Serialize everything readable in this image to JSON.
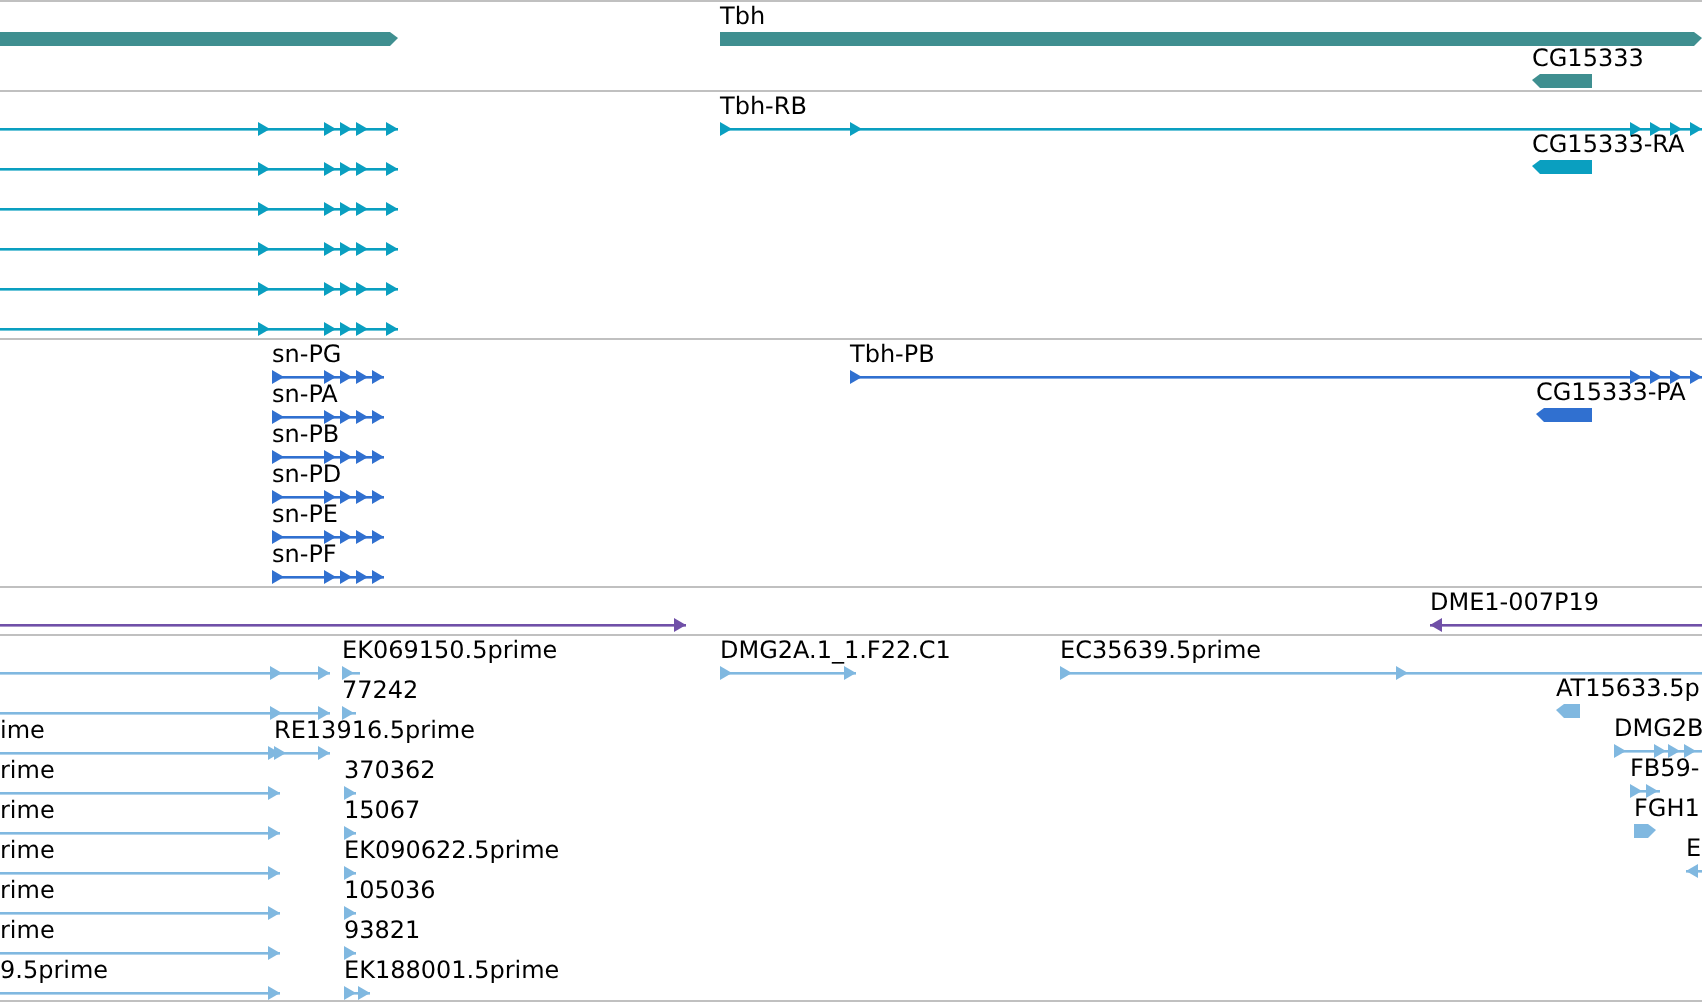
{
  "tracks": [
    {
      "kind": "gene",
      "features": [
        {
          "reverse": false
        },
        {
          "label": "Tbh",
          "reverse": false
        },
        {
          "label": "CG15333",
          "reverse": true
        }
      ]
    },
    {
      "kind": "transcript",
      "features": [
        {
          "reverse": false
        },
        {
          "reverse": false
        },
        {
          "reverse": false
        },
        {
          "reverse": false
        },
        {
          "reverse": false
        },
        {
          "reverse": false
        },
        {
          "label": "Tbh-RB",
          "reverse": false
        },
        {
          "label": "CG15333-RA",
          "reverse": true
        }
      ]
    },
    {
      "kind": "protein",
      "features": [
        {
          "label": "sn-PG",
          "reverse": false
        },
        {
          "label": "Tbh-PB",
          "reverse": false
        },
        {
          "label": "sn-PA",
          "reverse": false
        },
        {
          "label": "CG15333-PA",
          "reverse": true
        },
        {
          "label": "sn-PB",
          "reverse": false
        },
        {
          "label": "sn-PD",
          "reverse": false
        },
        {
          "label": "sn-PE",
          "reverse": false
        },
        {
          "label": "sn-PF",
          "reverse": false
        }
      ]
    },
    {
      "kind": "clone",
      "features": [
        {
          "reverse": false
        },
        {
          "label": "DME1-007P19",
          "reverse": true
        }
      ]
    },
    {
      "kind": "est",
      "features": [
        {
          "reverse": false
        },
        {
          "label": "EK069150.5prime",
          "reverse": false
        },
        {
          "label": "DMG2A.1_1.F22.C1",
          "reverse": false
        },
        {
          "label": "EC35639.5prime",
          "reverse": false
        },
        {
          "reverse": false
        },
        {
          "label": "77242",
          "reverse": false
        },
        {
          "label": "AT15633.5p",
          "reverse": true
        },
        {
          "label": "ime",
          "reverse": false
        },
        {
          "label": "RE13916.5prime",
          "reverse": false
        },
        {
          "label": "DMG2B",
          "reverse": false
        },
        {
          "label": "rime",
          "reverse": false
        },
        {
          "label": "370362",
          "reverse": false
        },
        {
          "label": "FB59-",
          "reverse": false
        },
        {
          "label": "rime",
          "reverse": false
        },
        {
          "label": "15067",
          "reverse": false
        },
        {
          "label": "FGH1",
          "reverse": false
        },
        {
          "label": "rime",
          "reverse": false
        },
        {
          "label": "EK090622.5prime",
          "reverse": false
        },
        {
          "label": "E",
          "reverse": true
        },
        {
          "label": "rime",
          "reverse": false
        },
        {
          "label": "105036",
          "reverse": false
        },
        {
          "label": "rime",
          "reverse": false
        },
        {
          "label": "93821",
          "reverse": false
        },
        {
          "label": "9.5prime",
          "reverse": false
        },
        {
          "label": "EK188001.5prime",
          "reverse": false
        }
      ]
    }
  ]
}
